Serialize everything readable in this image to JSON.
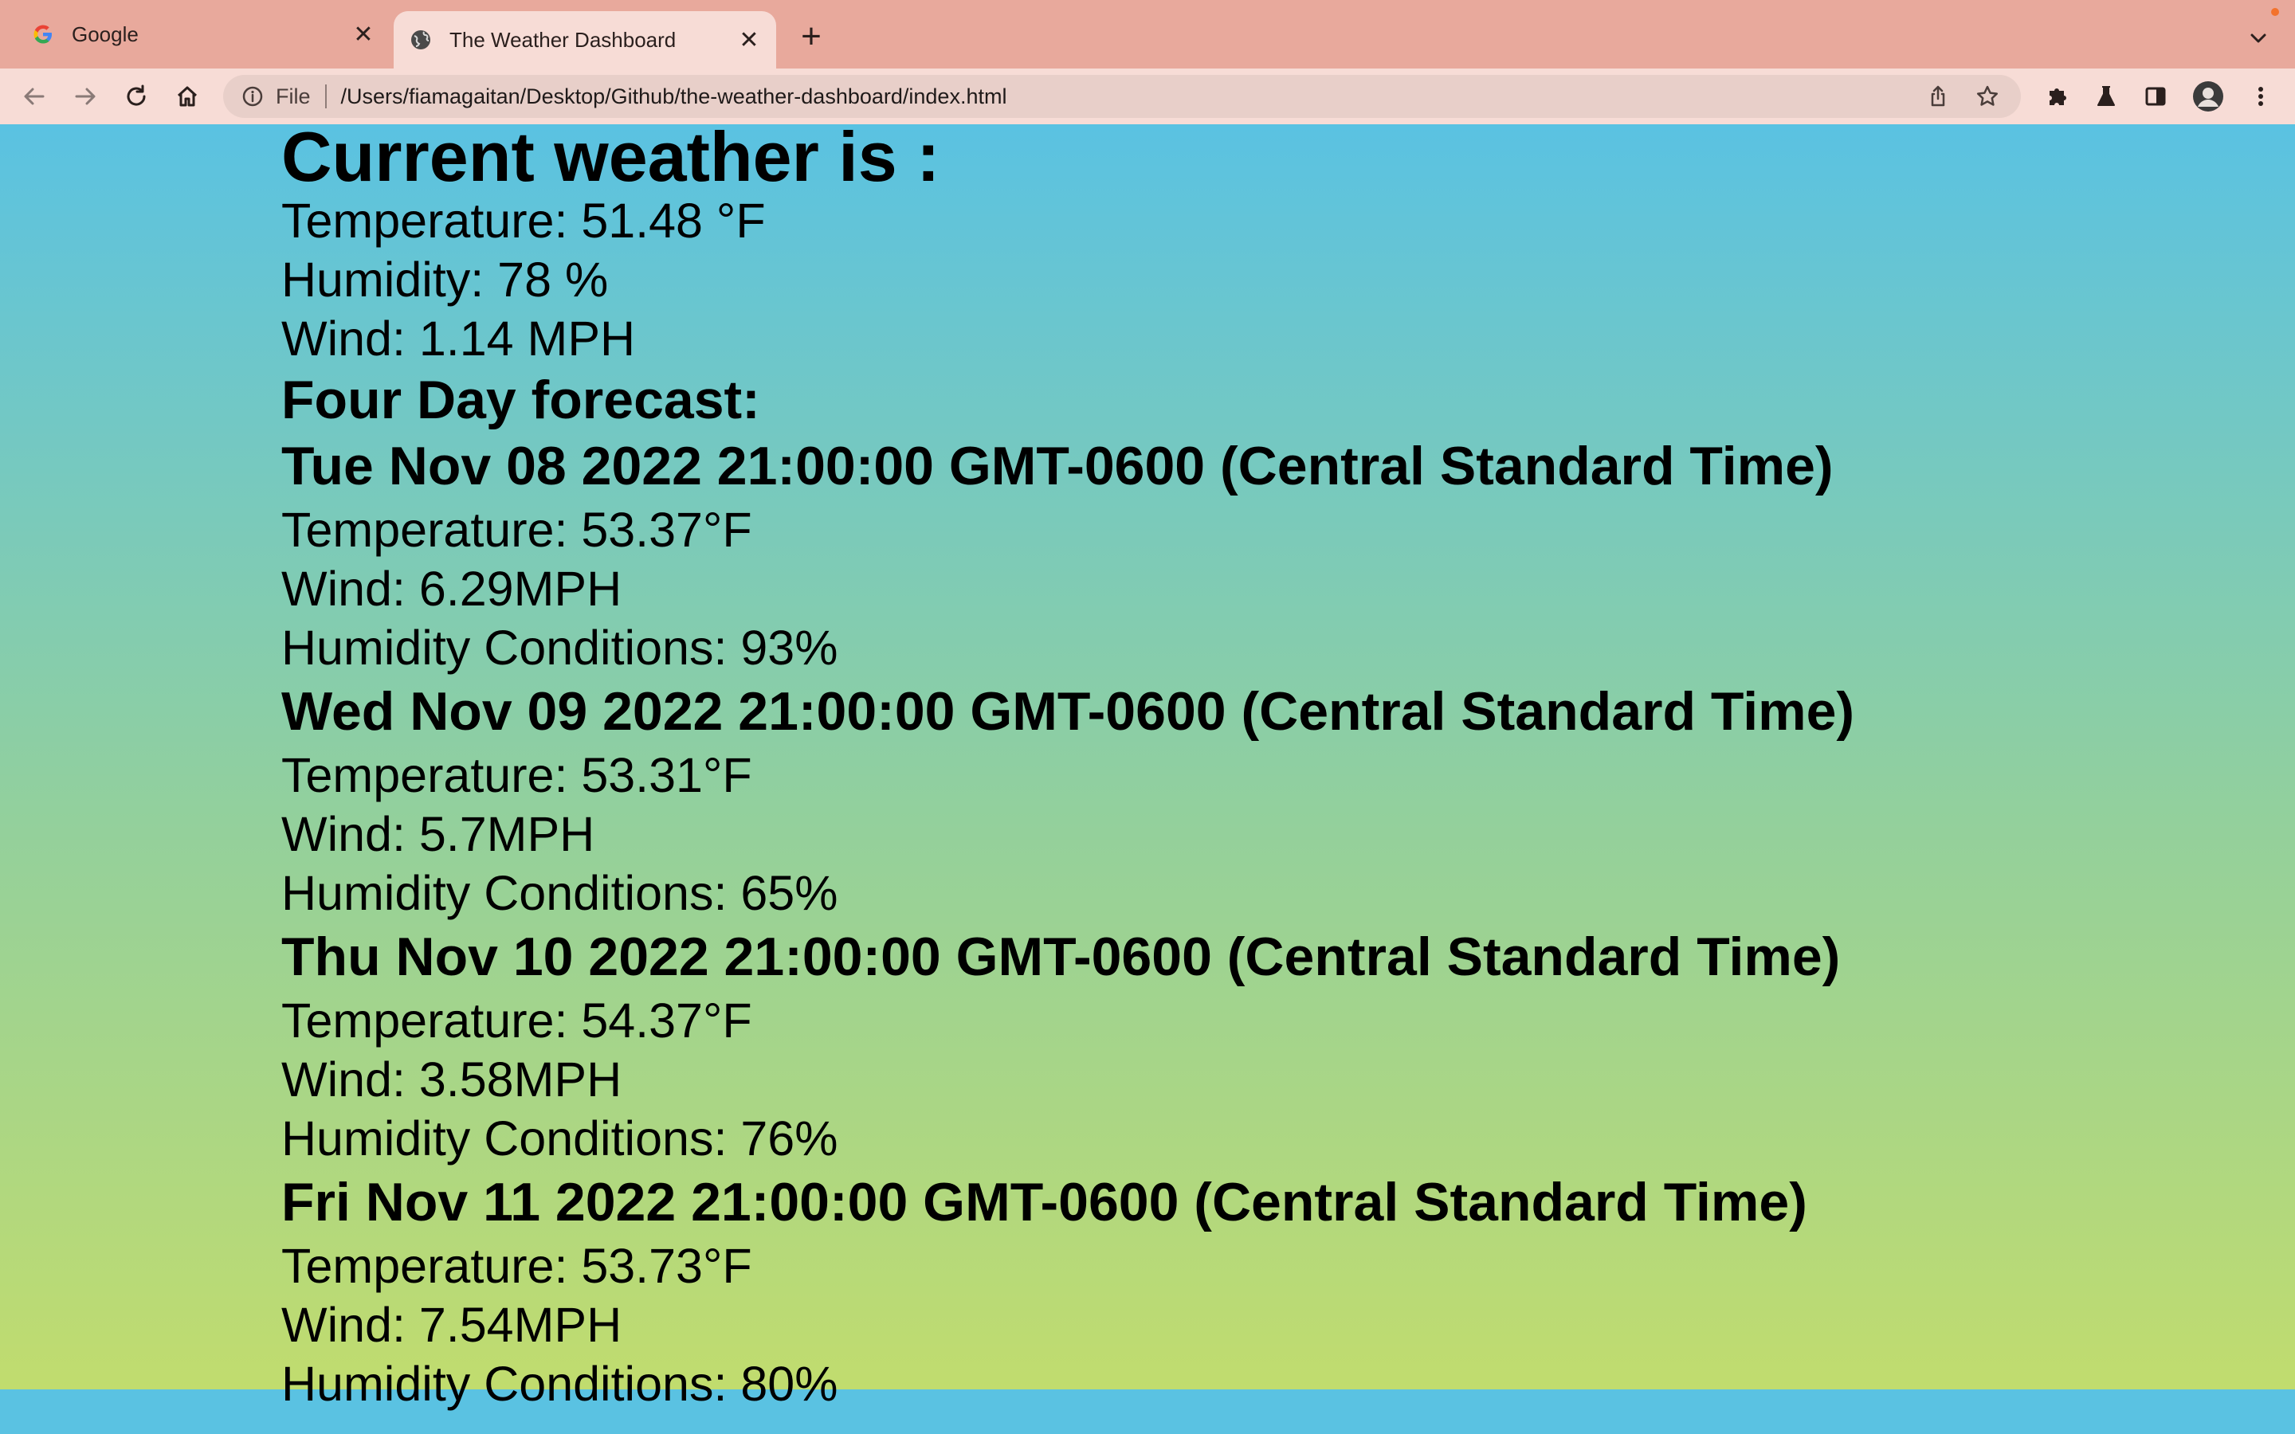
{
  "browser": {
    "tabs": [
      {
        "title": "Google",
        "favicon": "google-g-icon",
        "active": false
      },
      {
        "title": "The Weather Dashboard",
        "favicon": "globe-icon",
        "active": true
      }
    ],
    "address": {
      "scheme_label": "File",
      "url": "/Users/fiamagaitan/Desktop/Github/the-weather-dashboard/index.html"
    },
    "colors": {
      "tabstrip": "#e8a99c",
      "toolbar": "#f7dcd6",
      "omnibox": "#e8cfc9"
    }
  },
  "weather": {
    "current": {
      "heading": "Current weather is :",
      "temperature": "Temperature: 51.48 °F",
      "humidity": "Humidity: 78 %",
      "wind": "Wind: 1.14 MPH"
    },
    "forecast_heading": "Four Day forecast:",
    "forecast": [
      {
        "date": "Tue Nov 08 2022 21:00:00 GMT-0600 (Central Standard Time)",
        "temperature": "Temperature: 53.37°F",
        "wind": "Wind: 6.29MPH",
        "humidity": "Humidity Conditions: 93%"
      },
      {
        "date": "Wed Nov 09 2022 21:00:00 GMT-0600 (Central Standard Time)",
        "temperature": "Temperature: 53.31°F",
        "wind": "Wind: 5.7MPH",
        "humidity": "Humidity Conditions: 65%"
      },
      {
        "date": "Thu Nov 10 2022 21:00:00 GMT-0600 (Central Standard Time)",
        "temperature": "Temperature: 54.37°F",
        "wind": "Wind: 3.58MPH",
        "humidity": "Humidity Conditions: 76%"
      },
      {
        "date": "Fri Nov 11 2022 21:00:00 GMT-0600 (Central Standard Time)",
        "temperature": "Temperature: 53.73°F",
        "wind": "Wind: 7.54MPH",
        "humidity": "Humidity Conditions: 80%"
      }
    ]
  }
}
